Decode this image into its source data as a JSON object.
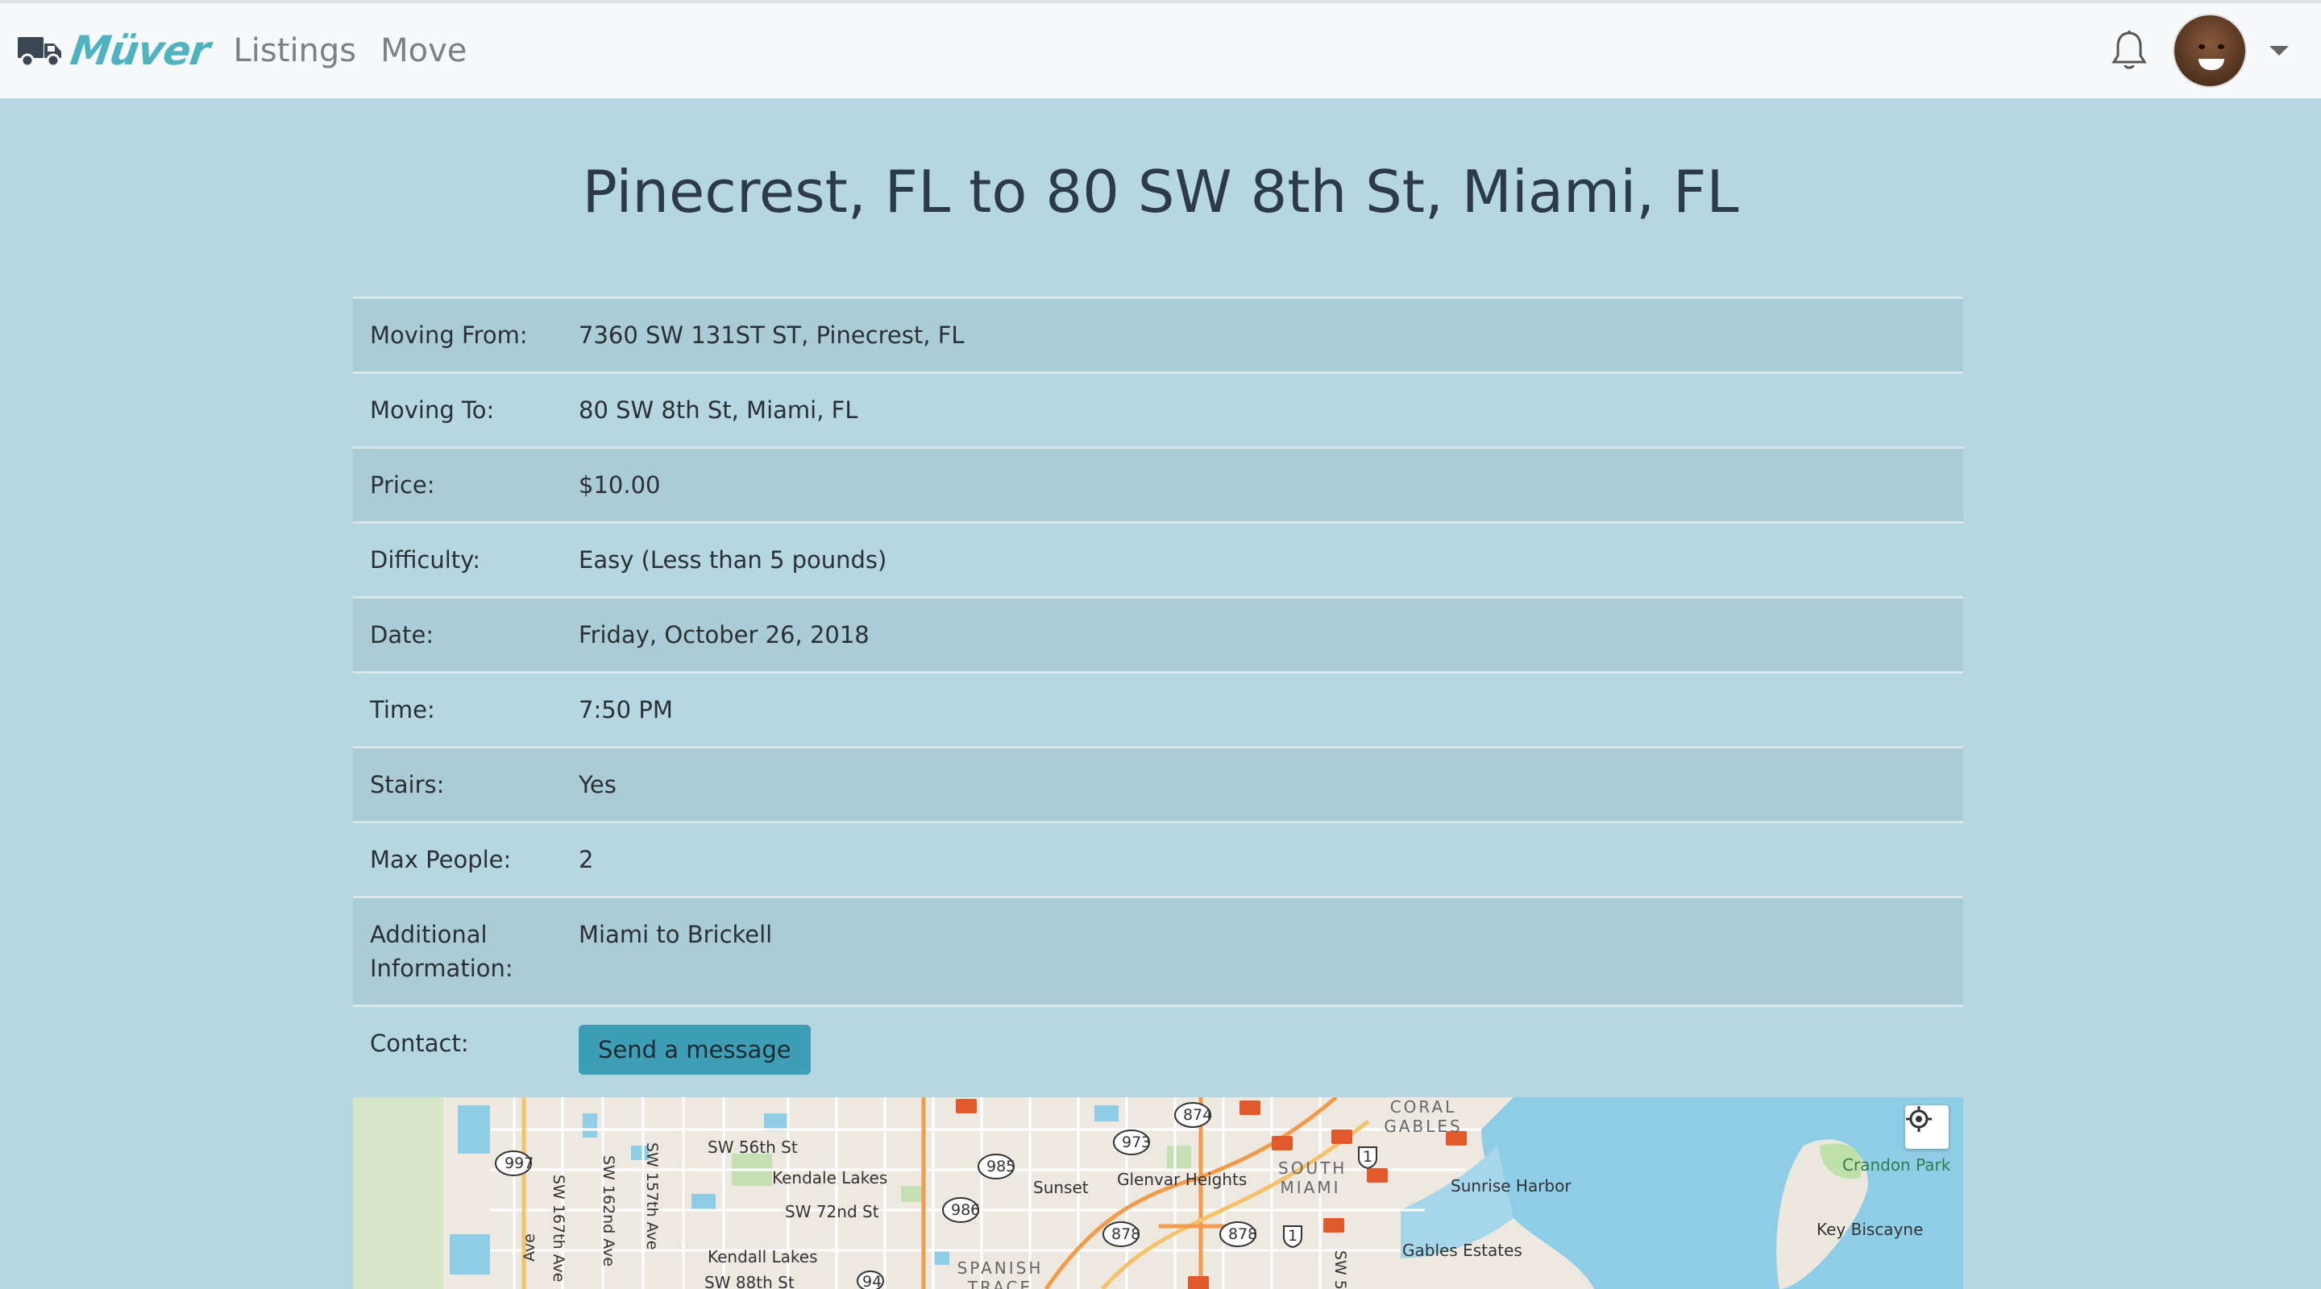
{
  "nav": {
    "brand": "Müver",
    "links": [
      "Listings",
      "Move"
    ]
  },
  "page": {
    "title": "Pinecrest, FL to 80 SW 8th St, Miami, FL"
  },
  "details": [
    {
      "label": "Moving From:",
      "value": "7360 SW 131ST ST, Pinecrest, FL"
    },
    {
      "label": "Moving To:",
      "value": "80 SW 8th St, Miami, FL"
    },
    {
      "label": "Price:",
      "value": "$10.00"
    },
    {
      "label": "Difficulty:",
      "value": "Easy (Less than 5 pounds)"
    },
    {
      "label": "Date:",
      "value": "Friday, October 26, 2018"
    },
    {
      "label": "Time:",
      "value": "7:50 PM"
    },
    {
      "label": "Stairs:",
      "value": "Yes"
    },
    {
      "label": "Max People:",
      "value": "2"
    },
    {
      "label": "Additional Information:",
      "value": "Miami to Brickell"
    }
  ],
  "contact": {
    "label": "Contact:",
    "button": "Send a message"
  },
  "map": {
    "labels": {
      "sw56": "SW 56th St",
      "kendale_lakes": "Kendale Lakes",
      "sw72": "SW 72nd St",
      "kendall_lakes": "Kendall Lakes",
      "sw88": "SW 88th St",
      "sunset": "Sunset",
      "glenvar": "Glenvar Heights",
      "south_miami": "SOUTH MIAMI",
      "coral_gables": "CORAL GABLES",
      "sunrise_harbor": "Sunrise Harbor",
      "gables_estates": "Gables Estates",
      "crandon_park": "Crandon Park",
      "key_biscayne": "Key Biscayne",
      "spanish_trace": "SPANISH TRACE",
      "sw167": "SW 167th Ave",
      "sw162": "SW 162nd Ave",
      "sw157": "SW 157th Ave",
      "ave": "Ave",
      "sw5": "SW 5"
    },
    "shields": [
      "997",
      "985",
      "986",
      "973",
      "874",
      "878",
      "878",
      "1",
      "1",
      "94"
    ]
  }
}
